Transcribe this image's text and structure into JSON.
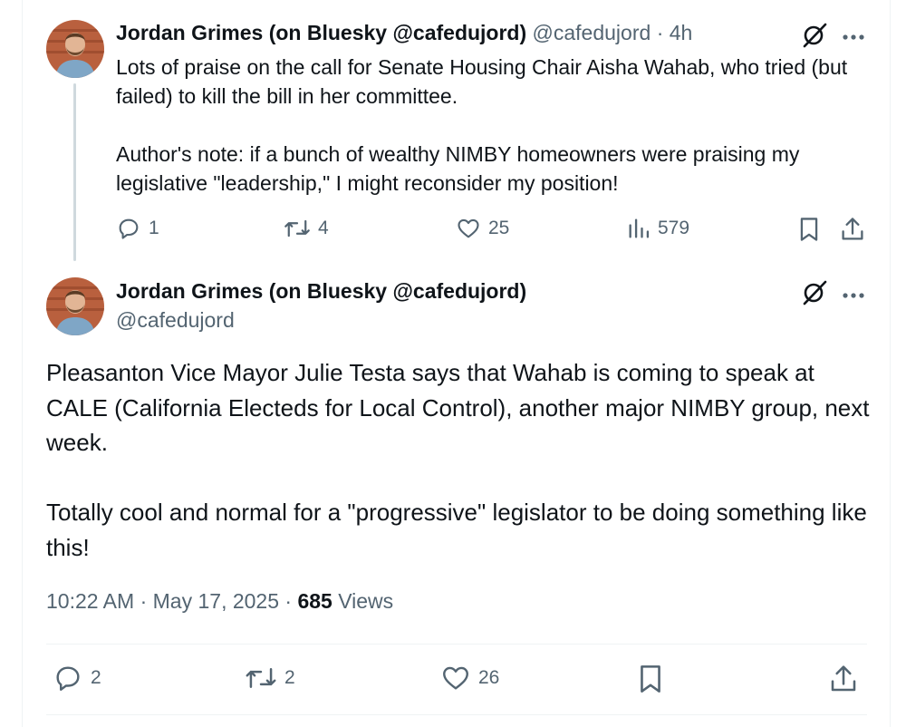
{
  "reply_tweet": {
    "display_name": "Jordan Grimes (on Bluesky @cafedujord)",
    "handle": "@cafedujord",
    "separator": "·",
    "time_ago": "4h",
    "text": "Lots of praise on the call for Senate Housing Chair Aisha Wahab, who tried (but failed) to kill the bill in her committee.\n\nAuthor's note: if a bunch of wealthy NIMBY homeowners were praising my legislative \"leadership,\" I might reconsider my position!",
    "replies": "1",
    "reposts": "4",
    "likes": "25",
    "views": "579"
  },
  "main_tweet": {
    "display_name": "Jordan Grimes (on Bluesky @cafedujord)",
    "handle": "@cafedujord",
    "text": "Pleasanton Vice Mayor Julie Testa says that Wahab is coming to speak at CALE (California Electeds for Local Control), another major NIMBY group, next week.\n\nTotally cool and normal for a \"progressive\" legislator to be doing something like this!",
    "time": "10:22 AM",
    "date": "May 17, 2025",
    "separator": "·",
    "views_count": "685",
    "views_label": "Views",
    "replies": "2",
    "reposts": "2",
    "likes": "26"
  },
  "icons": [
    "avatar-photo",
    "grok-icon",
    "more-icon",
    "reply-icon",
    "repost-icon",
    "like-icon",
    "views-icon",
    "bookmark-icon",
    "share-icon"
  ],
  "colors": {
    "text": "#0f1419",
    "muted": "#536471",
    "thread_line": "#cfd9de",
    "divider": "#eff3f4"
  }
}
